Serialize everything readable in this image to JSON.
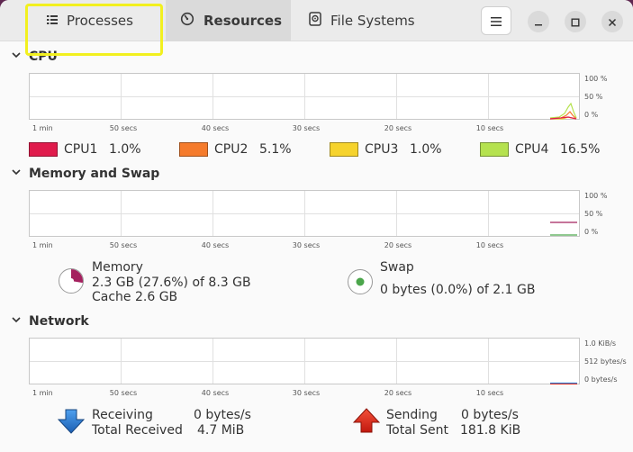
{
  "tabs": [
    {
      "label": "Processes",
      "icon": "list-icon"
    },
    {
      "label": "Resources",
      "icon": "gauge-icon",
      "active": true
    },
    {
      "label": "File Systems",
      "icon": "disk-icon"
    }
  ],
  "sections": {
    "cpu": "CPU",
    "memory": "Memory and Swap",
    "network": "Network"
  },
  "x_labels": [
    "1 min",
    "50 secs",
    "40 secs",
    "30 secs",
    "20 secs",
    "10 secs"
  ],
  "cpu_y_labels": [
    "100 %",
    "50 %",
    "0 %"
  ],
  "mem_y_labels": [
    "100 %",
    "50 %",
    "0 %"
  ],
  "net_y_labels": [
    "1.0 KiB/s",
    "512 bytes/s",
    "0 bytes/s"
  ],
  "cpu_legend": [
    {
      "name": "CPU1",
      "value": "1.0%",
      "color": "#e01b4c"
    },
    {
      "name": "CPU2",
      "value": "5.1%",
      "color": "#f57b2c"
    },
    {
      "name": "CPU3",
      "value": "1.0%",
      "color": "#f6d32d"
    },
    {
      "name": "CPU4",
      "value": "16.5%",
      "color": "#b5e24f"
    }
  ],
  "memory": {
    "label": "Memory",
    "usage": "2.3 GB (27.6%) of 8.3 GB",
    "cache": "Cache 2.6 GB",
    "fraction": 0.276,
    "color": "#a4205e"
  },
  "swap": {
    "label": "Swap",
    "usage": "0 bytes (0.0%) of 2.1 GB",
    "fraction": 0.0,
    "color": "#4ca64c"
  },
  "network": {
    "receiving_label": "Receiving",
    "receiving_value": "0 bytes/s",
    "total_received_label": "Total Received",
    "total_received_value": "4.7 MiB",
    "sending_label": "Sending",
    "sending_value": "0 bytes/s",
    "total_sent_label": "Total Sent",
    "total_sent_value": "181.8 KiB",
    "receive_color": "#2f7fd6",
    "send_color": "#e8301f"
  }
}
